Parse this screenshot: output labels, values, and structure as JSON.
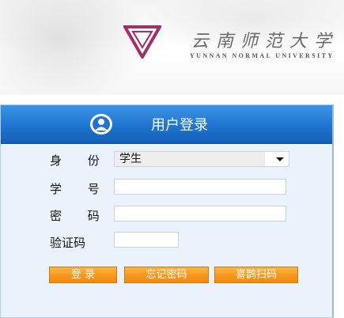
{
  "header": {
    "school_name_cn": "云南师范大学",
    "school_name_en": "YUNNAN NORMAL UNIVERSITY"
  },
  "login": {
    "title": "用户登录",
    "identity_label": "身 份",
    "identity_value": "学生",
    "student_id_label": "学 号",
    "student_id_value": "",
    "password_label": "密 码",
    "password_value": "",
    "captcha_label": "验证码",
    "captcha_value": "",
    "login_button": "登 录",
    "forgot_button": "忘记密码",
    "scan_button": "喜鹊扫码"
  },
  "colors": {
    "header_blue": "#1f74d0",
    "button_orange": "#f79a1e",
    "logo_purple": "#a0306a"
  }
}
